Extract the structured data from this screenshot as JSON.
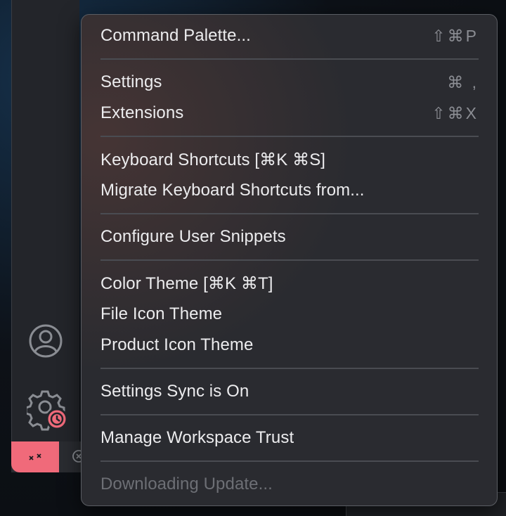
{
  "menu": {
    "groups": [
      {
        "items": [
          {
            "label": "Command Palette...",
            "shortcut": "⇧⌘P"
          }
        ]
      },
      {
        "items": [
          {
            "label": "Settings",
            "shortcut": "⌘ ,"
          },
          {
            "label": "Extensions",
            "shortcut": "⇧⌘X"
          }
        ]
      },
      {
        "items": [
          {
            "label": "Keyboard Shortcuts [⌘K ⌘S]",
            "shortcut": ""
          },
          {
            "label": "Migrate Keyboard Shortcuts from...",
            "shortcut": ""
          }
        ]
      },
      {
        "items": [
          {
            "label": "Configure User Snippets",
            "shortcut": ""
          }
        ]
      },
      {
        "items": [
          {
            "label": "Color Theme [⌘K ⌘T]",
            "shortcut": ""
          },
          {
            "label": "File Icon Theme",
            "shortcut": ""
          },
          {
            "label": "Product Icon Theme",
            "shortcut": ""
          }
        ]
      },
      {
        "items": [
          {
            "label": "Settings Sync is On",
            "shortcut": ""
          }
        ]
      },
      {
        "items": [
          {
            "label": "Manage Workspace Trust",
            "shortcut": ""
          }
        ]
      },
      {
        "items": [
          {
            "label": "Downloading Update...",
            "shortcut": "",
            "disabled": true
          }
        ]
      }
    ]
  },
  "activity_bar": {
    "icons": [
      "account-icon",
      "gear-icon"
    ],
    "update_badge_icon": "clock-icon"
  },
  "status_bar": {
    "remote_icon": "remote-icon",
    "error_icon": "error-icon"
  },
  "colors": {
    "remote_indicator": "#f06a7a",
    "menu_background": "#2a2b30",
    "menu_text": "#ececee",
    "shortcut_text": "#8b8d93",
    "disabled_text": "#6d6f75"
  }
}
